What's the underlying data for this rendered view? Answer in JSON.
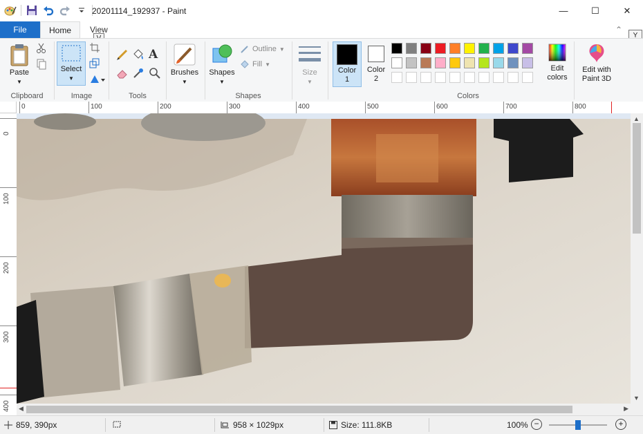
{
  "window": {
    "title": "20201114_192937 - Paint",
    "minimize_glyph": "—",
    "maximize_glyph": "☐",
    "close_glyph": "✕"
  },
  "tabs": {
    "file": "File",
    "home": "Home",
    "view": "View"
  },
  "keytips": {
    "view": "V",
    "help": "Y"
  },
  "ribbon": {
    "clipboard": {
      "label": "Clipboard",
      "paste": "Paste"
    },
    "image": {
      "label": "Image",
      "select": "Select"
    },
    "tools": {
      "label": "Tools"
    },
    "brushes": "Brushes",
    "shapes": {
      "label": "Shapes",
      "button": "Shapes",
      "outline": "Outline",
      "fill": "Fill"
    },
    "size": "Size",
    "color1": {
      "line1": "Color",
      "line2": "1"
    },
    "color2": {
      "line1": "Color",
      "line2": "2"
    },
    "colors_label": "Colors",
    "edit_colors": {
      "line1": "Edit",
      "line2": "colors"
    },
    "paint3d": {
      "line1": "Edit with",
      "line2": "Paint 3D"
    }
  },
  "palette": {
    "row1": [
      "#000000",
      "#7f7f7f",
      "#880015",
      "#ed1c24",
      "#ff7f27",
      "#fff200",
      "#22b14c",
      "#00a2e8",
      "#3f48cc",
      "#a349a4"
    ],
    "row2": [
      "#ffffff",
      "#c3c3c3",
      "#b97a57",
      "#ffaec9",
      "#ffc90e",
      "#efe4b0",
      "#b5e61d",
      "#99d9ea",
      "#7092be",
      "#c8bfe7"
    ]
  },
  "ruler": {
    "h": [
      "0",
      "100",
      "200",
      "300",
      "400",
      "500",
      "600",
      "700",
      "800"
    ],
    "v": [
      "0",
      "100",
      "200",
      "300",
      "400"
    ]
  },
  "status": {
    "cursor": "859, 390px",
    "dimensions": "958 × 1029px",
    "size": "Size: 111.8KB",
    "zoom": "100%",
    "zoom_fraction": 0.5
  }
}
